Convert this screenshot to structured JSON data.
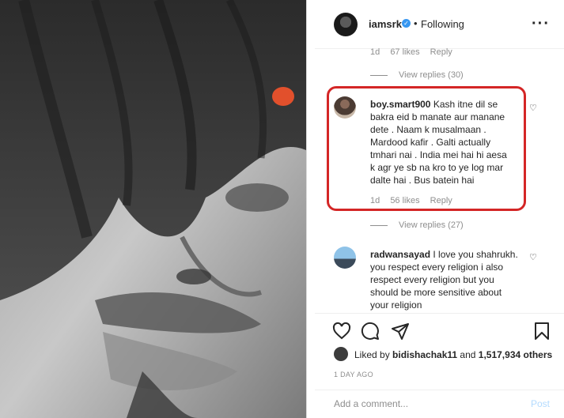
{
  "header": {
    "username": "iamsrk",
    "separator": "•",
    "follow_status": "Following",
    "more_icon": "more-horizontal-icon"
  },
  "top_comment_meta": {
    "time": "1d",
    "likes": "67 likes",
    "reply": "Reply"
  },
  "view_replies_1": "View replies (30)",
  "comment_1": {
    "username": "boy.smart900",
    "text": "Kash itne dil se bakra eid b manate aur manane dete . Naam k musalmaan . Mardood kafir . Galti actually tmhari nai . India mei hai hi aesa k agr ye sb na kro to ye log mar dalte hai . Bus batein hai",
    "time": "1d",
    "likes": "56 likes",
    "reply": "Reply"
  },
  "view_replies_2": "View replies (27)",
  "comment_2": {
    "username": "radwansayad",
    "text": "I love you shahrukh. you respect every religion i also respect every religion but you should be more sensitive about your religion"
  },
  "likes": {
    "prefix": "Liked by ",
    "user": "bidishachak11",
    "middle": " and ",
    "count": "1,517,934 others"
  },
  "timestamp": "1 DAY AGO",
  "add_comment": {
    "placeholder": "Add a comment...",
    "post_label": "Post"
  },
  "colors": {
    "highlight": "#d42626",
    "verified": "#3897f0",
    "post_disabled": "#b3dbff"
  }
}
